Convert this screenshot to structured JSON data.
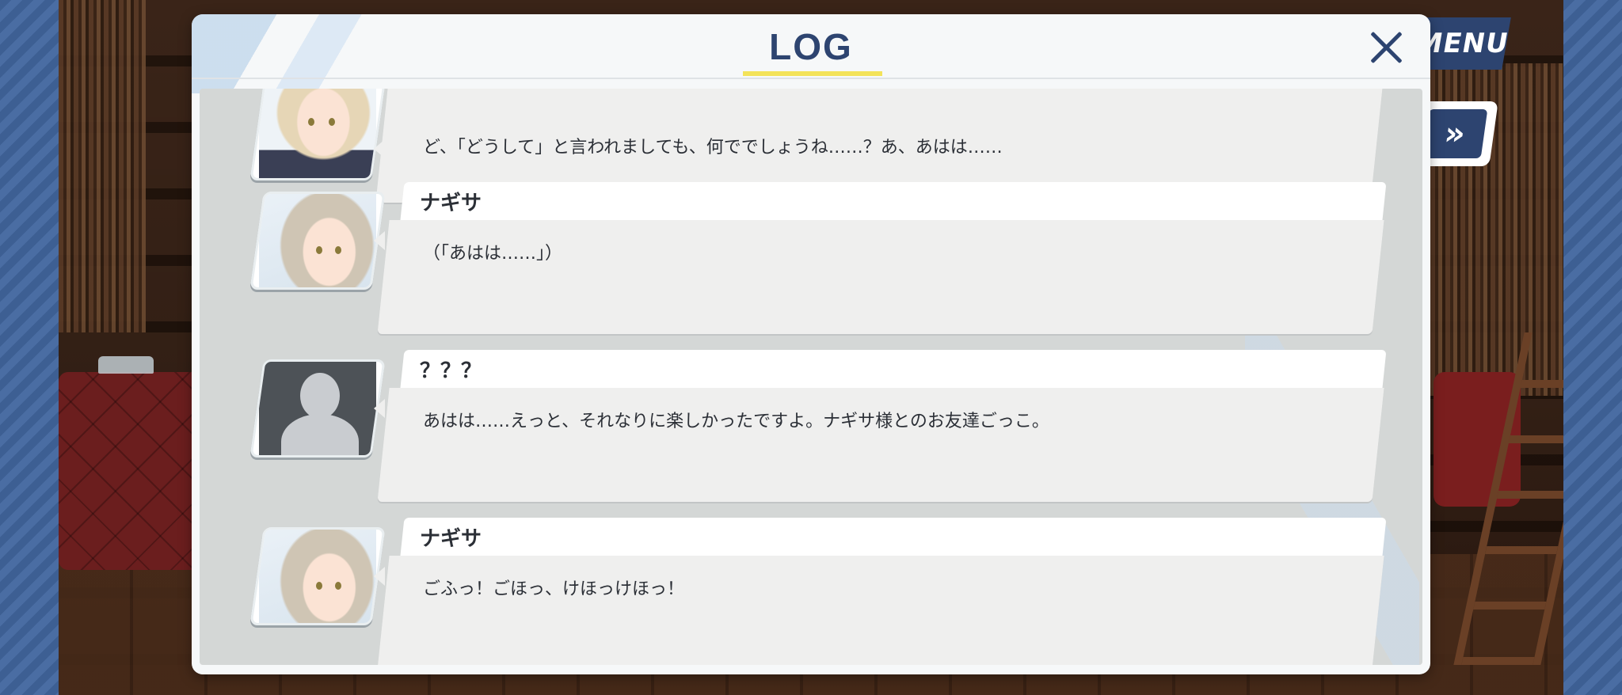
{
  "menu": {
    "label": "MENU"
  },
  "skip": {
    "label": "»"
  },
  "log_panel": {
    "title": "LOG",
    "accent_color": "#f3e35a",
    "title_color": "#2d4470",
    "close_icon": "close-icon"
  },
  "entries": [
    {
      "speaker": "",
      "portrait": "student-portrait",
      "message": "ど、「どうして」と言われましても、何ででしょうね……？あ、あはは……"
    },
    {
      "speaker": "ナギサ",
      "portrait": "nagisa-portrait",
      "message": "（「あはは……」）"
    },
    {
      "speaker": "？？？",
      "portrait": "unknown-silhouette",
      "message": "あはは……えっと、それなりに楽しかったですよ。ナギサ様とのお友達ごっこ。"
    },
    {
      "speaker": "ナギサ",
      "portrait": "nagisa-portrait",
      "message": "ごふっ！ごほっ、けほっけほっ！"
    }
  ]
}
